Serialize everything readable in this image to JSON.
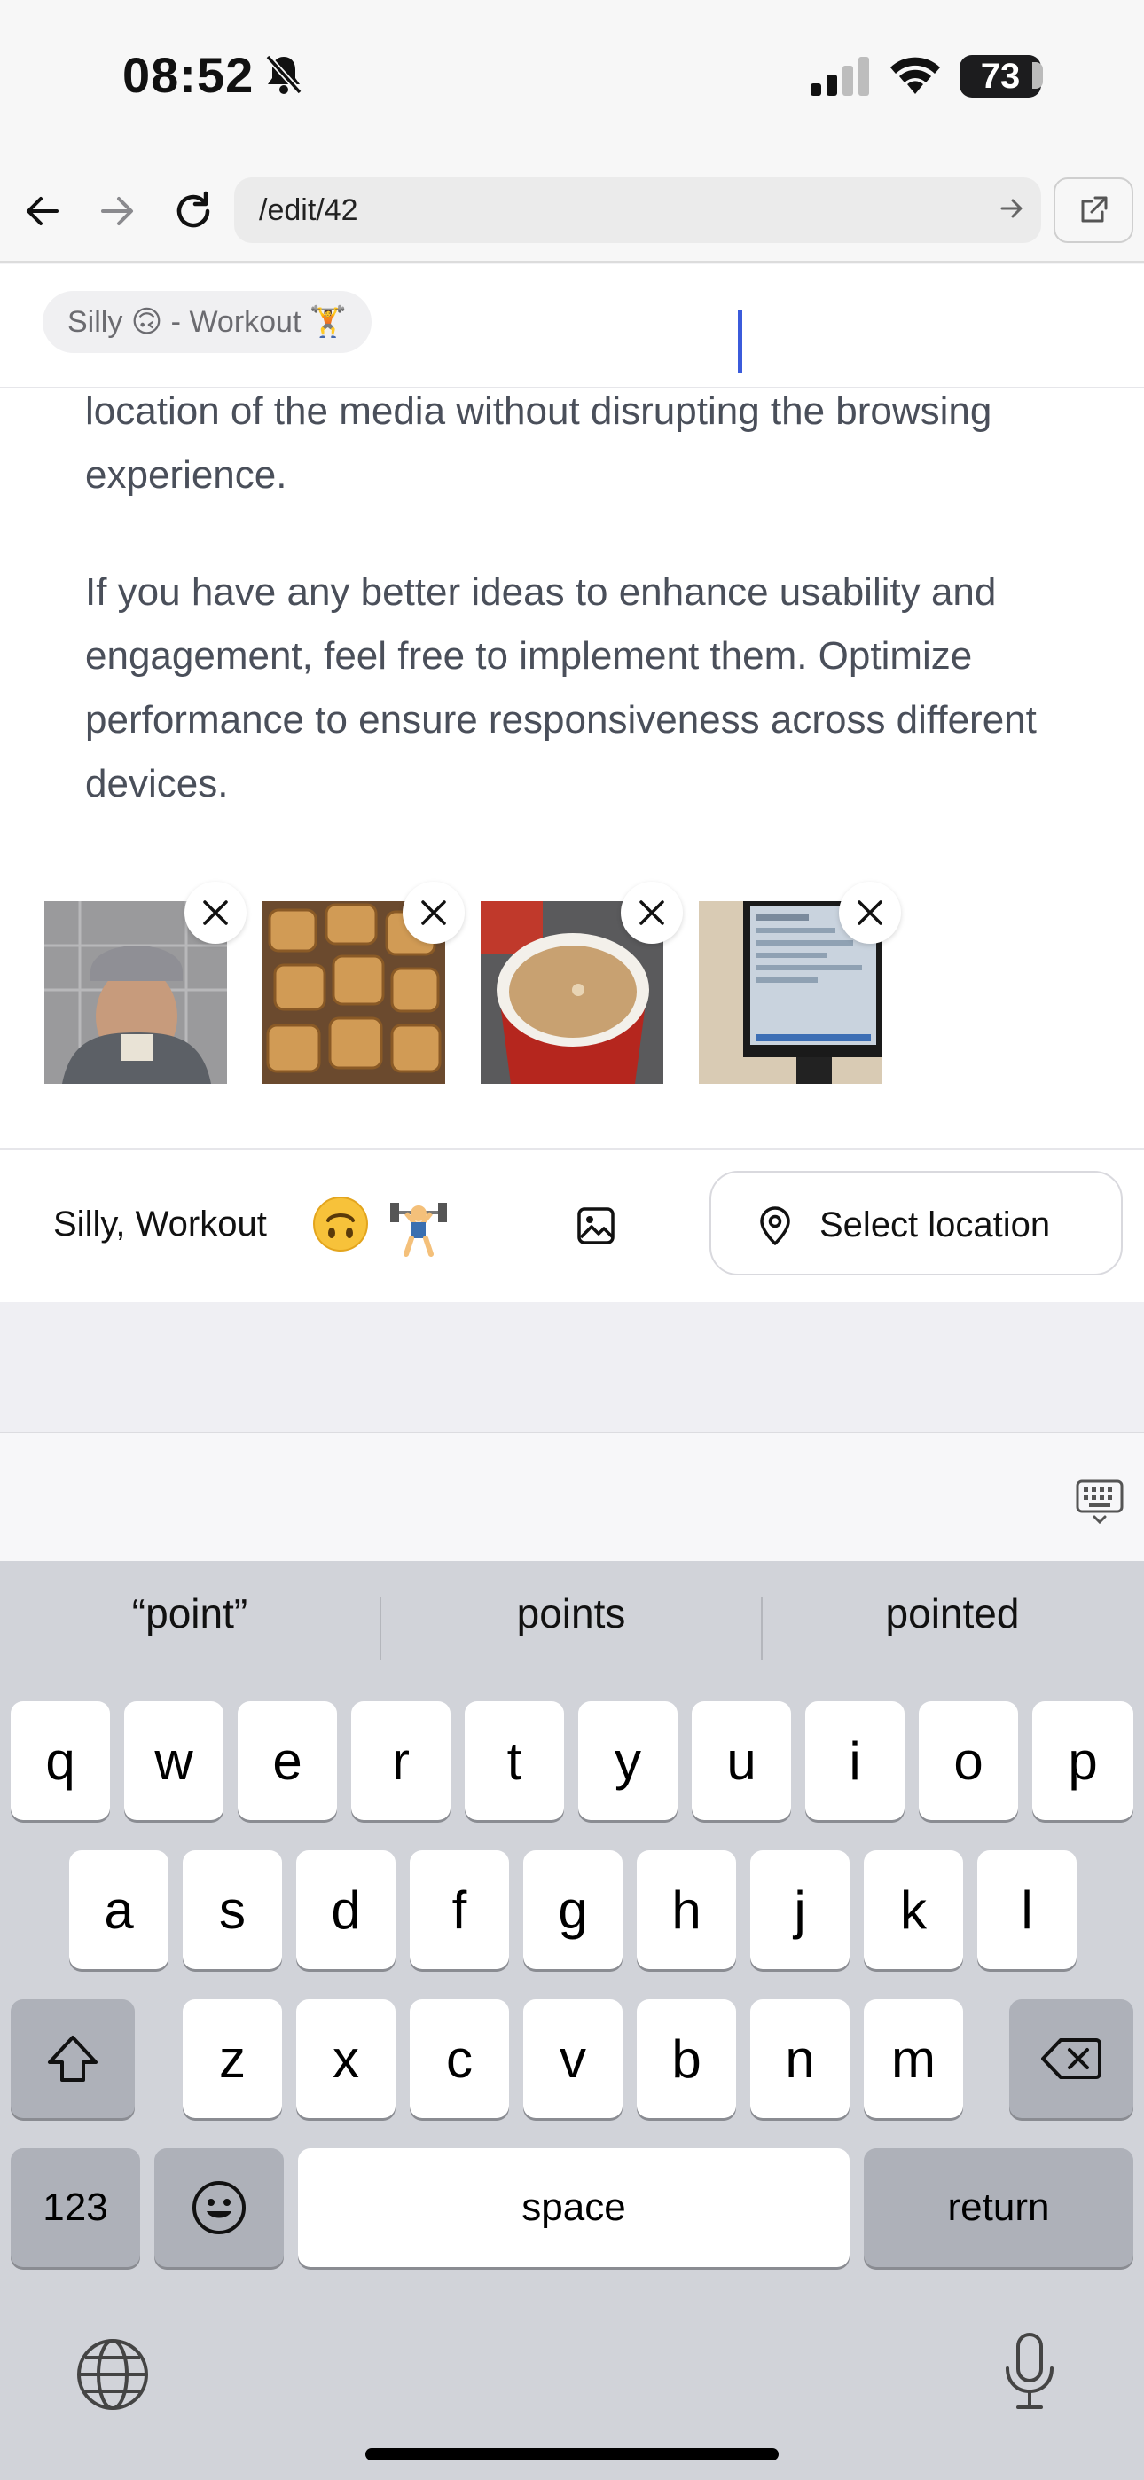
{
  "status_bar": {
    "time": "08:52",
    "battery": "73"
  },
  "browser": {
    "url": "/edit/42"
  },
  "tag_bar": {
    "chip": "Silly 🙃 - Workout 🏋️"
  },
  "content": {
    "paragraph1": "location of the media without disrupting the browsing experience.",
    "paragraph2": "If you have any better ideas to enhance usability and engagement, feel free to implement them. Optimize performance to ensure responsiveness across different devices."
  },
  "media": [
    {
      "name": "selfie photo"
    },
    {
      "name": "pastries photo"
    },
    {
      "name": "milk tea photo"
    },
    {
      "name": "monitor photo"
    }
  ],
  "toolbar": {
    "mood_label": "Silly, Workout",
    "emoji_1": "🙃",
    "emoji_2": "🏋️",
    "location_label": "Select location"
  },
  "keyboard": {
    "suggestions": [
      "“point”",
      "points",
      "pointed"
    ],
    "row1": [
      "q",
      "w",
      "e",
      "r",
      "t",
      "y",
      "u",
      "i",
      "o",
      "p"
    ],
    "row2": [
      "a",
      "s",
      "d",
      "f",
      "g",
      "h",
      "j",
      "k",
      "l"
    ],
    "row3": [
      "z",
      "x",
      "c",
      "v",
      "b",
      "n",
      "m"
    ],
    "numbers_key": "123",
    "space_key": "space",
    "return_key": "return"
  }
}
